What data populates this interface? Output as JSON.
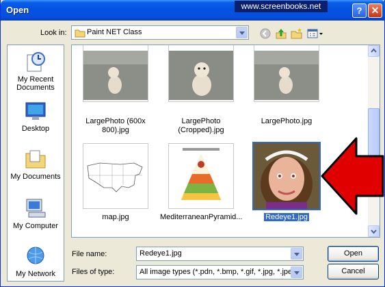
{
  "window": {
    "title": "Open",
    "watermark": "www.screenbooks.net"
  },
  "toolbar": {
    "look_in_label": "Look in:",
    "look_in_value": "Paint NET Class",
    "icons": [
      "back-icon",
      "up-folder-icon",
      "new-folder-icon",
      "views-menu-icon"
    ]
  },
  "places": [
    {
      "label": "My Recent Documents",
      "icon": "recent-documents-icon"
    },
    {
      "label": "Desktop",
      "icon": "desktop-icon"
    },
    {
      "label": "My Documents",
      "icon": "my-documents-icon"
    },
    {
      "label": "My Computer",
      "icon": "my-computer-icon"
    },
    {
      "label": "My Network",
      "icon": "my-network-icon"
    }
  ],
  "files": [
    {
      "name": "LargePhoto (600x 800).jpg",
      "selected": false
    },
    {
      "name": "LargePhoto (Cropped).jpg",
      "selected": false
    },
    {
      "name": "LargePhoto.jpg",
      "selected": false
    },
    {
      "name": "map.jpg",
      "selected": false
    },
    {
      "name": "MediterraneanPyramid...",
      "selected": false
    },
    {
      "name": "Redeye1.jpg",
      "selected": true
    }
  ],
  "form": {
    "file_name_label": "File name:",
    "file_name_value": "Redeye1.jpg",
    "file_type_label": "Files of type:",
    "file_type_value": "All image types (*.pdn, *.bmp, *.gif, *.jpg, *.jpeg,"
  },
  "buttons": {
    "open": "Open",
    "cancel": "Cancel"
  },
  "colors": {
    "title_bar": "#0553e2",
    "selection": "#316ac5",
    "annotation_arrow": "#e00000"
  }
}
